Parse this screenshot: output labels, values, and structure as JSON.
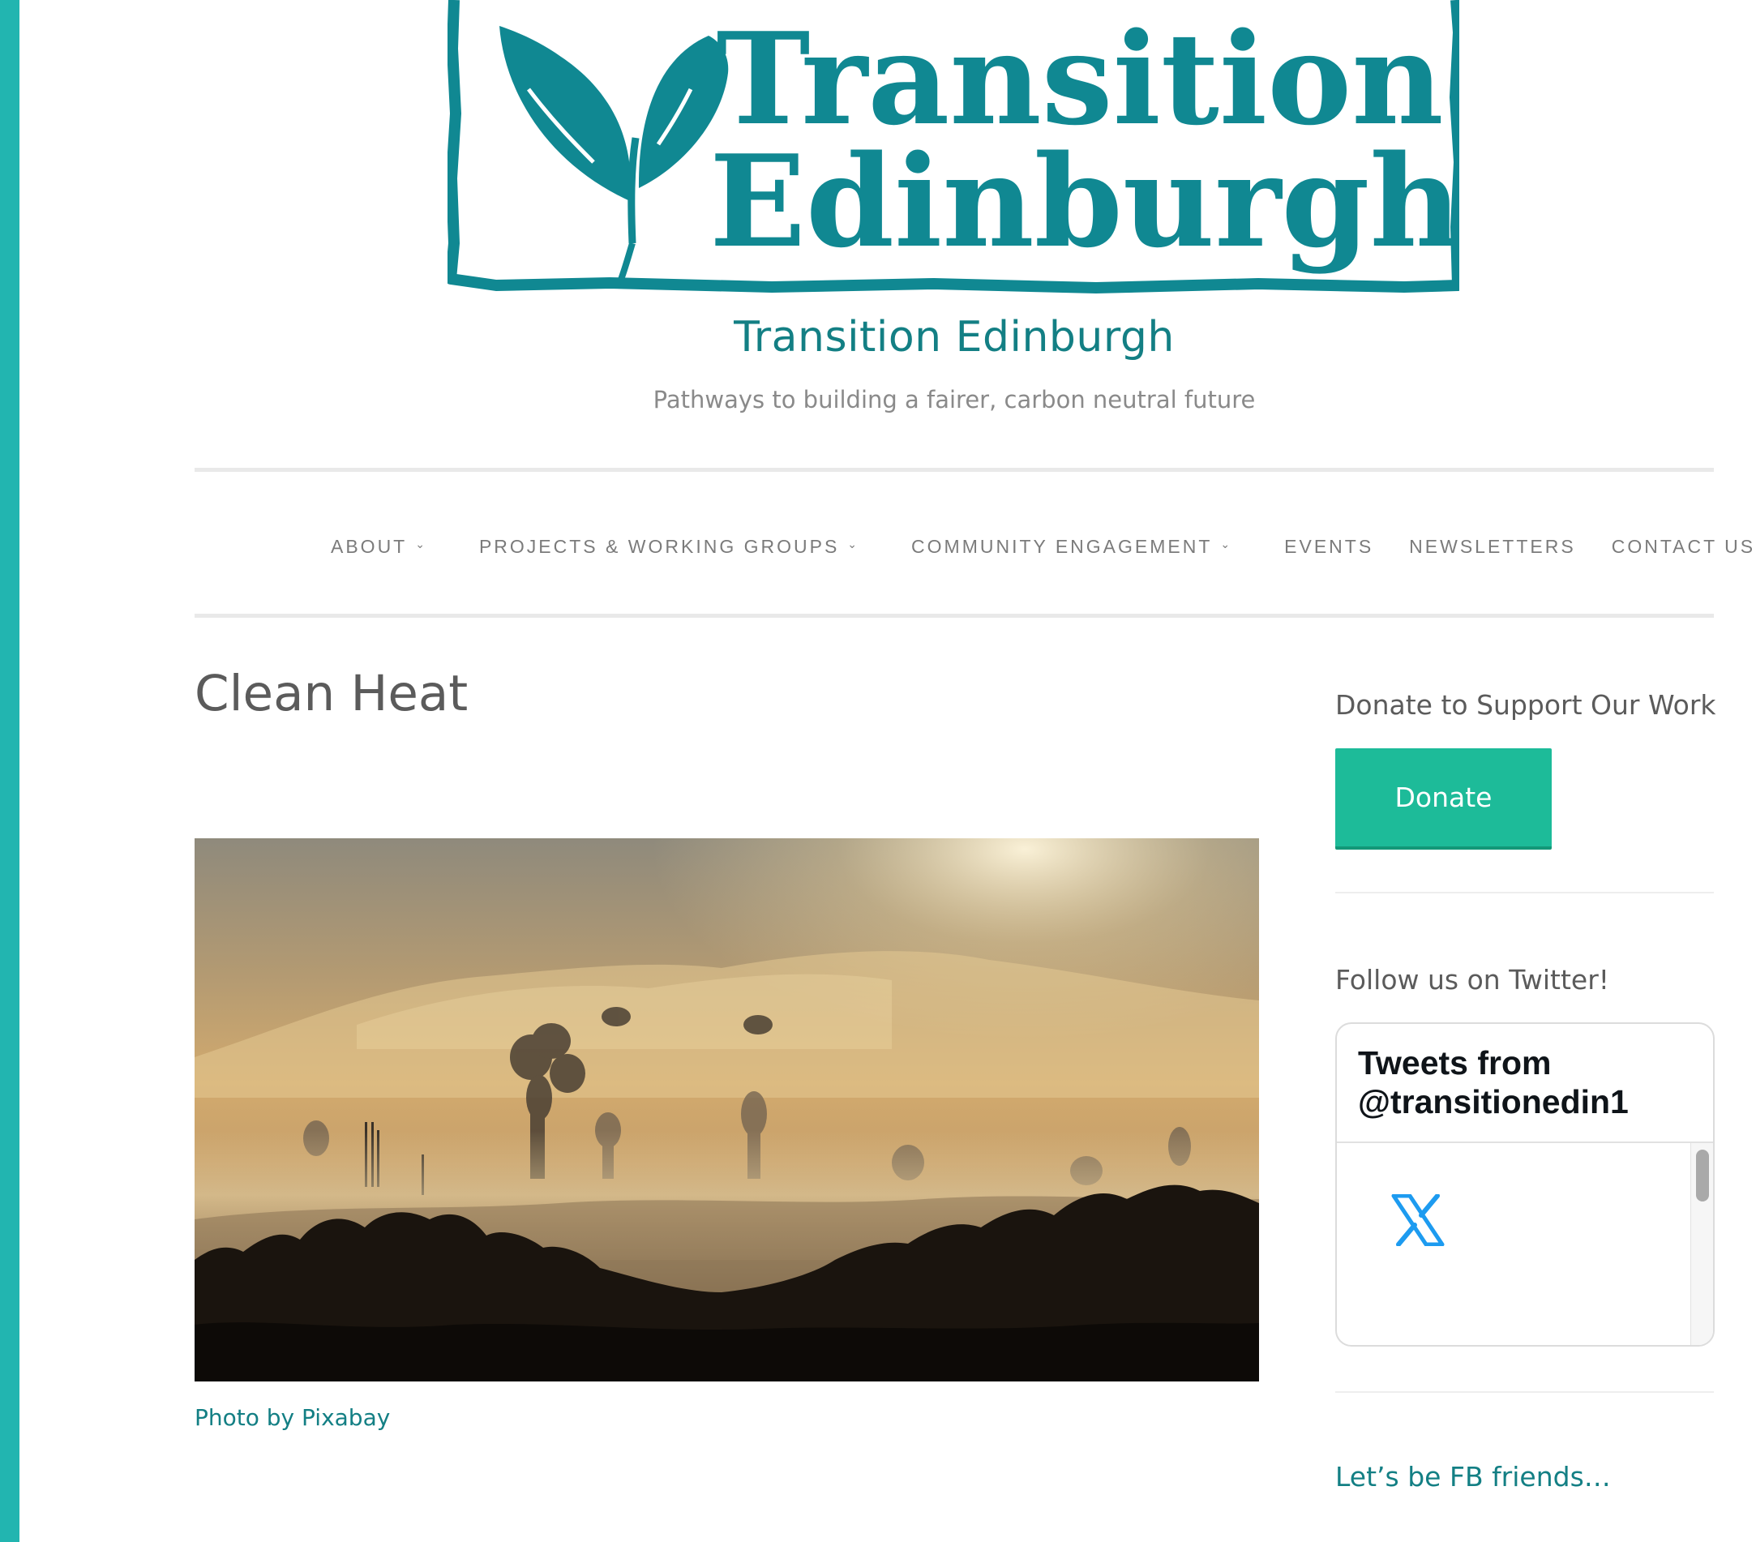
{
  "colors": {
    "accent_teal": "#137f84",
    "logo_teal": "#108892",
    "left_bar": "#22b5b0",
    "donate_green": "#1dbb99",
    "x_blue": "#1d9bf0"
  },
  "logo": {
    "line1": "Transition",
    "line2": "Edinburgh",
    "icon": "leaf-sprout-icon"
  },
  "site": {
    "title": "Transition Edinburgh",
    "tagline": "Pathways to building a fairer, carbon neutral future"
  },
  "nav": {
    "items": [
      {
        "label": "ABOUT",
        "has_dropdown": true
      },
      {
        "label": "PROJECTS & WORKING GROUPS",
        "has_dropdown": true
      },
      {
        "label": "COMMUNITY ENGAGEMENT",
        "has_dropdown": true
      },
      {
        "label": "EVENTS",
        "has_dropdown": false
      },
      {
        "label": "NEWSLETTERS",
        "has_dropdown": false
      },
      {
        "label": "CONTACT US",
        "has_dropdown": false
      }
    ],
    "dropdown_icon": "chevron-down-icon"
  },
  "main": {
    "page_title": "Clean Heat",
    "hero_alt": "Industrial smoke stacks over misty landscape at sunrise",
    "caption": "Photo by Pixabay"
  },
  "sidebar": {
    "donate_title": "Donate to Support Our Work",
    "donate_button": "Donate",
    "twitter_title": "Follow us on Twitter!",
    "twitter_header": "Tweets from @transitionedin1",
    "twitter_icon": "x-logo-icon",
    "fb_link": "Let’s be FB friends…"
  }
}
